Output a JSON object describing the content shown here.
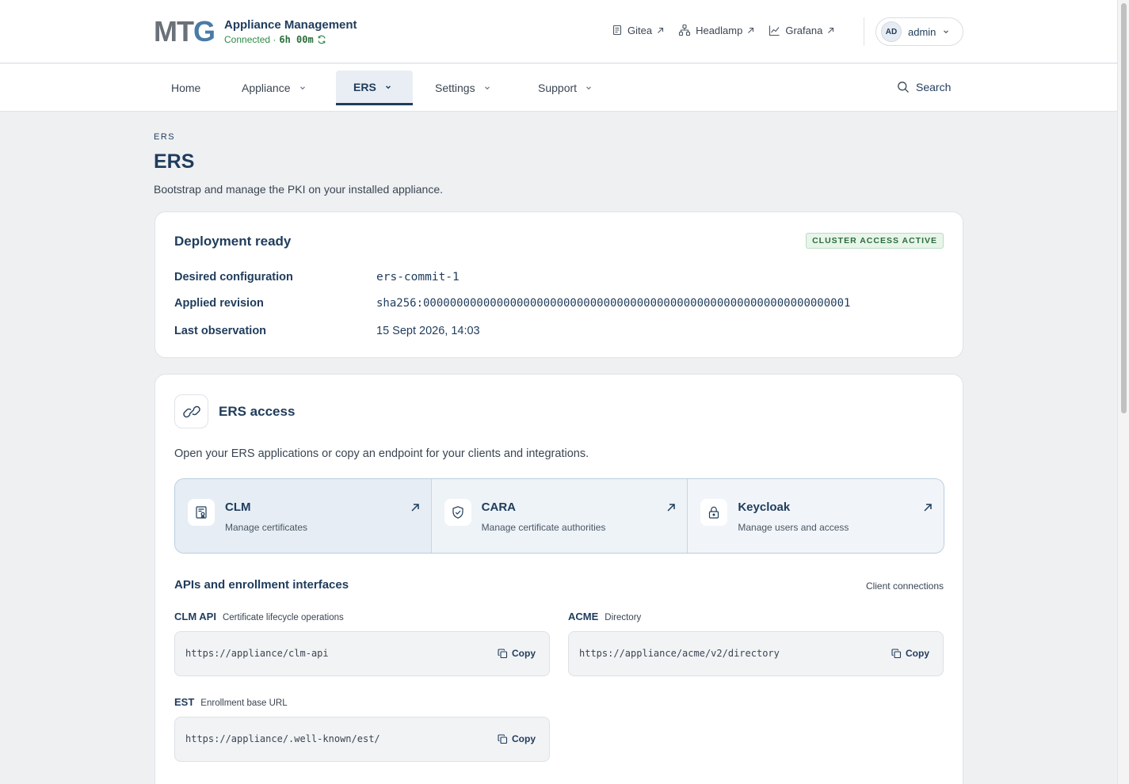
{
  "brand": {
    "logo": "MTG",
    "title": "Appliance Management",
    "status_prefix": "Connected ·",
    "uptime": "6h 00m"
  },
  "external_links": [
    {
      "label": "Gitea",
      "icon": "document-icon"
    },
    {
      "label": "Headlamp",
      "icon": "network-icon"
    },
    {
      "label": "Grafana",
      "icon": "chart-line-icon"
    }
  ],
  "user": {
    "initials": "AD",
    "name": "admin"
  },
  "nav": {
    "items": [
      {
        "label": "Home"
      },
      {
        "label": "Appliance"
      },
      {
        "label": "ERS"
      },
      {
        "label": "Settings"
      },
      {
        "label": "Support"
      }
    ],
    "active": "ERS",
    "search_label": "Search"
  },
  "page": {
    "breadcrumb": "ERS",
    "title": "ERS",
    "subtitle": "Bootstrap and manage the PKI on your installed appliance."
  },
  "deployment": {
    "title": "Deployment ready",
    "badge": "CLUSTER ACCESS ACTIVE",
    "rows": [
      {
        "label": "Desired configuration",
        "value": "ers-commit-1"
      },
      {
        "label": "Applied revision",
        "value": "sha256:0000000000000000000000000000000000000000000000000000000000000001"
      },
      {
        "label": "Last observation",
        "value": "15 Sept 2026, 14:03"
      }
    ]
  },
  "access": {
    "title": "ERS access",
    "description": "Open your ERS applications or copy an endpoint for your clients and integrations.",
    "apps": [
      {
        "name": "CLM",
        "description": "Manage certificates",
        "icon": "certificate-icon"
      },
      {
        "name": "CARA",
        "description": "Manage certificate authorities",
        "icon": "shield-check-icon"
      },
      {
        "name": "Keycloak",
        "description": "Manage users and access",
        "icon": "lock-icon"
      }
    ],
    "apis_title": "APIs and enrollment interfaces",
    "apis_link": "Client connections",
    "endpoints": [
      {
        "name": "CLM API",
        "description": "Certificate lifecycle operations",
        "url": "https://appliance/clm-api",
        "copy_label": "Copy"
      },
      {
        "name": "ACME",
        "description": "Directory",
        "url": "https://appliance/acme/v2/directory",
        "copy_label": "Copy"
      },
      {
        "name": "EST",
        "description": "Enrollment base URL",
        "url": "https://appliance/.well-known/est/",
        "copy_label": "Copy"
      }
    ]
  },
  "colors": {
    "primary": "#1f3c5c",
    "success": "#2f8a45",
    "background": "#eef0f2"
  }
}
